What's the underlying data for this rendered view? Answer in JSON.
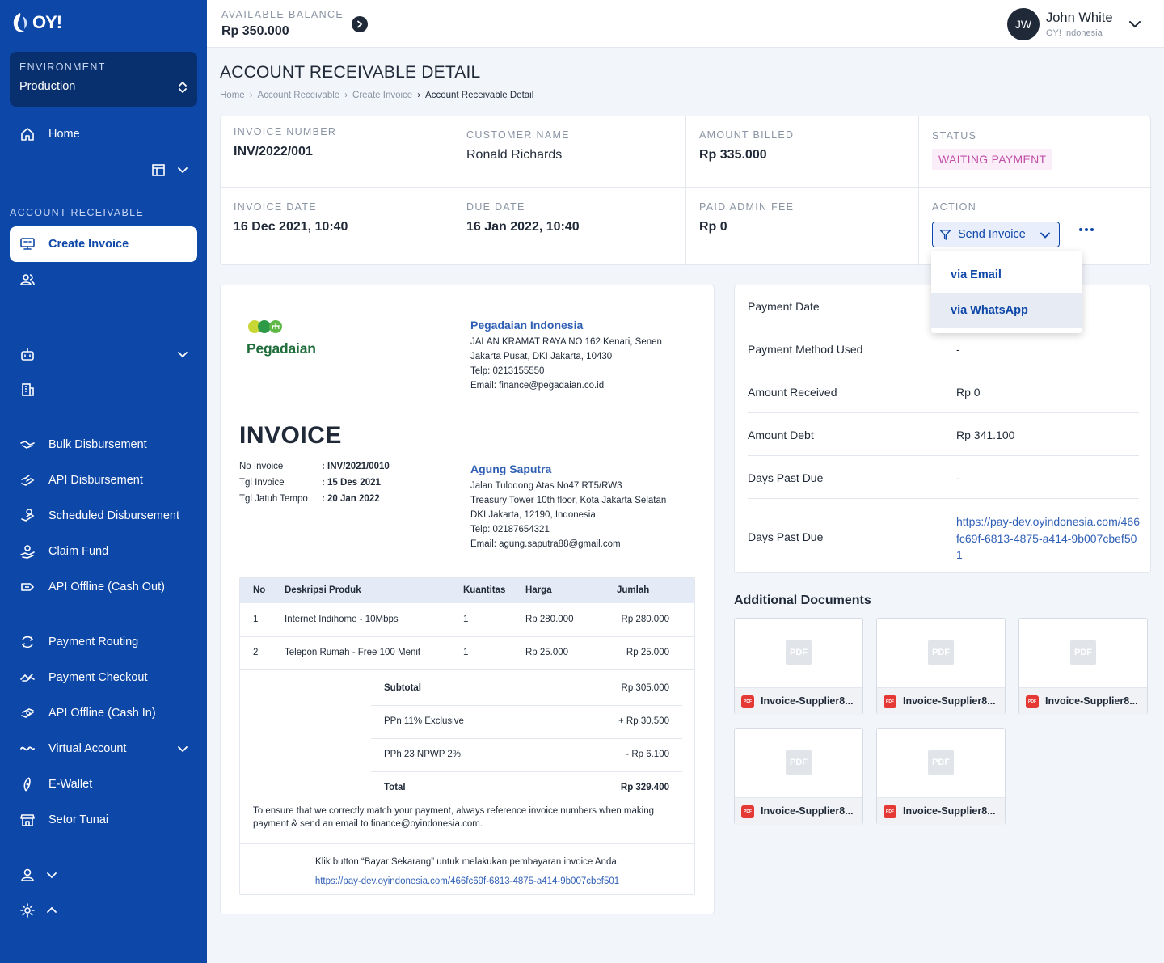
{
  "brand": {
    "logo_text": "OY!"
  },
  "environment": {
    "label": "ENVIRONMENT",
    "value": "Production"
  },
  "sidebar": {
    "home": "Home",
    "section_label": "ACCOUNT RECEIVABLE",
    "create_invoice": "Create Invoice",
    "items": [
      {
        "label": "Bulk Disbursement"
      },
      {
        "label": "API Disbursement"
      },
      {
        "label": "Scheduled Disbursement"
      },
      {
        "label": "Claim Fund"
      },
      {
        "label": "API Offline (Cash Out)"
      },
      {
        "label": "Payment Routing"
      },
      {
        "label": "Payment Checkout"
      },
      {
        "label": "API Offline (Cash In)"
      },
      {
        "label": "Virtual Account"
      },
      {
        "label": "E-Wallet"
      },
      {
        "label": "Setor Tunai"
      }
    ]
  },
  "topbar": {
    "balance_label": "AVAILABLE BALANCE",
    "balance_value": "Rp 350.000",
    "user_initials": "JW",
    "user_name": "John White",
    "user_org": "OY! Indonesia"
  },
  "page": {
    "title": "ACCOUNT RECEIVABLE DETAIL",
    "breadcrumb": [
      "Home",
      "Account Receivable",
      "Create Invoice",
      "Account Receivable Detail"
    ]
  },
  "summary": {
    "invoice_number_label": "INVOICE NUMBER",
    "invoice_number": "INV/2022/001",
    "customer_name_label": "CUSTOMER NAME",
    "customer_name": "Ronald Richards",
    "amount_billed_label": "AMOUNT BILLED",
    "amount_billed": "Rp 335.000",
    "status_label": "STATUS",
    "status": "WAITING PAYMENT",
    "invoice_date_label": "INVOICE DATE",
    "invoice_date": "16 Dec 2021, 10:40",
    "due_date_label": "DUE DATE",
    "due_date": "16 Jan 2022, 10:40",
    "admin_fee_label": "PAID ADMIN FEE",
    "admin_fee": "Rp 0",
    "action_label": "ACTION",
    "send_invoice": "Send Invoice",
    "send_options": [
      "via Email",
      "via WhatsApp"
    ]
  },
  "invoice": {
    "company_logo_text": "Pegadaian",
    "company_name": "Pegadaian Indonesia",
    "company_address": [
      "JALAN KRAMAT RAYA NO 162 Kenari, Senen",
      "Jakarta Pusat, DKI Jakarta, 10430",
      "Telp: 0213155550",
      "Email: finance@pegadaian.co.id"
    ],
    "heading": "INVOICE",
    "meta": [
      {
        "k": "No Invoice",
        "v": ": INV/2021/0010"
      },
      {
        "k": "Tgl Invoice",
        "v": ": 15 Des 2021"
      },
      {
        "k": "Tgl Jatuh Tempo",
        "v": ": 20 Jan 2022"
      }
    ],
    "customer_name": "Agung Saputra",
    "customer_address": [
      "Jalan Tulodong Atas No47 RT5/RW3",
      "Treasury Tower 10th floor, Kota Jakarta Selatan",
      "DKI Jakarta, 12190, Indonesia",
      "Telp: 02187654321",
      "Email: agung.saputra88@gmail.com"
    ],
    "columns": [
      "No",
      "Deskripsi Produk",
      "Kuantitas",
      "Harga",
      "Jumlah"
    ],
    "rows": [
      {
        "no": "1",
        "desc": "Internet Indihome - 10Mbps",
        "qty": "1",
        "price": "Rp 280.000",
        "total": "Rp 280.000"
      },
      {
        "no": "2",
        "desc": "Telepon Rumah - Free 100 Menit",
        "qty": "1",
        "price": "Rp 25.000",
        "total": "Rp 25.000"
      }
    ],
    "totals": [
      {
        "k": "Subtotal",
        "v": "Rp 305.000",
        "bold": true
      },
      {
        "k": "PPn 11% Exclusive",
        "v": "+ Rp 30.500",
        "bold": false
      },
      {
        "k": "PPh 23 NPWP 2%",
        "v": "- Rp 6.100",
        "bold": false
      },
      {
        "k": "Total",
        "v": "Rp 329.400",
        "bold": true
      }
    ],
    "note": "To ensure that we correctly match your payment, always reference invoice numbers when making payment & send an email to finance@oyindonesia.com.",
    "pay_instruction": "Klik button “Bayar Sekarang” untuk melakukan pembayaran invoice Anda.",
    "pay_link": "https://pay-dev.oyindonesia.com/466fc69f-6813-4875-a414-9b007cbef501"
  },
  "payment": [
    {
      "k": "Payment Date",
      "v": ""
    },
    {
      "k": "Payment Method Used",
      "v": "-"
    },
    {
      "k": "Amount Received",
      "v": "Rp 0"
    },
    {
      "k": "Amount Debt",
      "v": "Rp 341.100"
    },
    {
      "k": "Days Past Due",
      "v": "-"
    },
    {
      "k": "Days Past Due",
      "v": "https://pay-dev.oyindonesia.com/466fc69f-6813-4875-a414-9b007cbef501"
    }
  ],
  "documents": {
    "title": "Additional Documents",
    "thumb_label": "PDF",
    "file_icon_label": "PDF",
    "files": [
      "Invoice-Supplier8...",
      "Invoice-Supplier8...",
      "Invoice-Supplier8...",
      "Invoice-Supplier8...",
      "Invoice-Supplier8..."
    ]
  },
  "colors": {
    "sidebar": "#0d47a8",
    "accent": "#0d47a8",
    "link": "#2f5fb5",
    "status": "#c04fa8"
  }
}
